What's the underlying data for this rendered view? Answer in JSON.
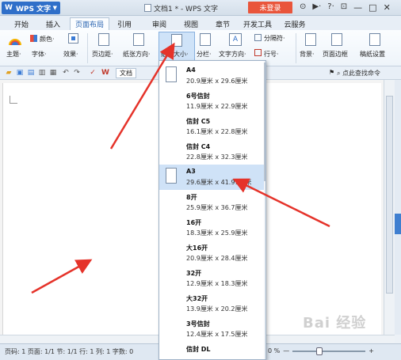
{
  "titlebar": {
    "app_name": "WPS 文字",
    "doc_title": "文档1 * - WPS 文字",
    "login_label": "未登录",
    "icon_labels": [
      "⊙",
      "▶·",
      "?·",
      "⊡",
      "—",
      "□",
      "✕"
    ]
  },
  "tabs": [
    {
      "label": "开始"
    },
    {
      "label": "插入"
    },
    {
      "label": "页面布局",
      "active": true
    },
    {
      "label": "引用"
    },
    {
      "label": "审阅"
    },
    {
      "label": "视图"
    },
    {
      "label": "章节"
    },
    {
      "label": "开发工具"
    },
    {
      "label": "云服务"
    }
  ],
  "ribbon": {
    "theme_label": "主题·",
    "color_label": "颜色·",
    "font_label": "字体·",
    "effect_label": "效果·",
    "margin_label": "页边距·",
    "orientation_label": "纸张方向·",
    "size_label": "纸张大小·",
    "columns_label": "分栏·",
    "text_dir_label": "文字方向·",
    "breaks_label": "分隔符·",
    "line_num_label": "行号·",
    "background_label": "背景·",
    "page_border_label": "页面边框",
    "draft_paper_label": "稿纸设置"
  },
  "quickbar": {
    "doc_tab_label": "文档",
    "search_label": "点此查找命令"
  },
  "paper_sizes": [
    {
      "name": "A4",
      "dims": "20.9厘米 x 29.6厘米",
      "icon": true
    },
    {
      "name": "6号信封",
      "dims": "11.9厘米 x 22.9厘米"
    },
    {
      "name": "信封 C5",
      "dims": "16.1厘米 x 22.8厘米"
    },
    {
      "name": "信封 C4",
      "dims": "22.8厘米 x 32.3厘米"
    },
    {
      "name": "A3",
      "dims": "29.6厘米 x 41.91厘米",
      "icon": true,
      "selected": true
    },
    {
      "name": "8开",
      "dims": "25.9厘米 x 36.7厘米"
    },
    {
      "name": "16开",
      "dims": "18.3厘米 x 25.9厘米"
    },
    {
      "name": "大16开",
      "dims": "20.9厘米 x 28.4厘米"
    },
    {
      "name": "32开",
      "dims": "12.9厘米 x 18.3厘米"
    },
    {
      "name": "大32开",
      "dims": "13.9厘米 x 20.2厘米"
    },
    {
      "name": "3号信封",
      "dims": "12.4厘米 x 17.5厘米"
    },
    {
      "name": "信封 DL",
      "dims": ""
    }
  ],
  "statusbar": {
    "text": "页码: 1  页面: 1/1  节: 1/1  行: 1  列: 1  字数: 0",
    "zoom_label": "0 %",
    "zoom_minus": "—",
    "zoom_plus": "+"
  },
  "watermark": "Bai 经验",
  "colors": {
    "accent": "#2f6fc9",
    "login": "#e9553b",
    "arrow": "#e5332a",
    "selected": "#cfe2f7"
  }
}
